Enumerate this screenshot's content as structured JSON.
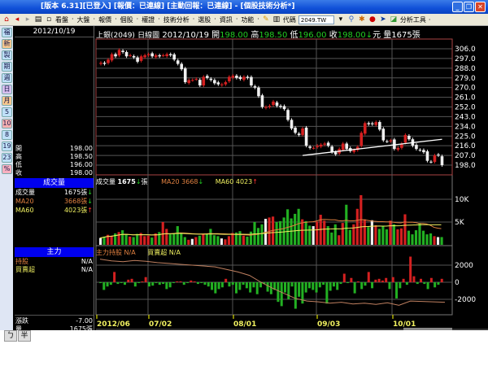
{
  "window": {
    "title": "[版本 6.31][已登入] [報價：已連線] [主動回報：已連線] - [個股技術分析*]"
  },
  "toolbar": {
    "menus": [
      "看盤",
      "大盤",
      "報價",
      "個股",
      "權證",
      "技術分析",
      "選股",
      "資訊",
      "功能"
    ],
    "code_label": "代碼",
    "code_value": "2049.TW",
    "analysis_tools": "分析工具"
  },
  "sidebar": {
    "buttons": [
      "福",
      "新",
      "製",
      "期",
      "週",
      "日",
      "月",
      "5",
      "10",
      "8",
      "19",
      "23",
      "%"
    ]
  },
  "info": {
    "date": "2012/10/19",
    "ohlc": [
      {
        "label": "開",
        "value": "198.00"
      },
      {
        "label": "高",
        "value": "198.50"
      },
      {
        "label": "低",
        "value": "196.00"
      },
      {
        "label": "收",
        "value": "198.00"
      }
    ],
    "volume_header": "成交量",
    "volume_rows": [
      {
        "label": "成交量",
        "value": "1675張",
        "arrow": "↓",
        "color": "#ffffff",
        "arrow_color": "#22cc22"
      },
      {
        "label": "MA20",
        "value": "3668張",
        "arrow": "↓",
        "color": "#e08040",
        "arrow_color": "#22cc22"
      },
      {
        "label": "MA60",
        "value": "4023張",
        "arrow": "↑",
        "color": "#f0f060",
        "arrow_color": "#ff3030"
      }
    ],
    "mainforce_header": "主力",
    "mainforce_rows": [
      {
        "label": "持股",
        "value": "N/A",
        "color": "#e08040"
      },
      {
        "label": "買賣超",
        "value": "N/A",
        "color": "#f0f060"
      }
    ],
    "change_label": "漲跌",
    "change_value": "-7.00",
    "vol_label": "量",
    "vol_value": "1675張"
  },
  "chart": {
    "stock": "上銀(2049)",
    "period": "日線圖",
    "date": "2012/10/19",
    "open_label": "開",
    "open": "198.00",
    "high_label": "高",
    "high": "198.50",
    "low_label": "低",
    "low": "196.00",
    "close_label": "收",
    "close": "198.00",
    "arrow": "↓",
    "unit": "元",
    "vol_label": "量",
    "vol": "1675",
    "vol_unit": "張",
    "volume_legend": {
      "label": "成交量",
      "value": "1675",
      "arrow": "↓",
      "unit": "張",
      "ma20": "MA20 3668",
      "ma20_arrow": "↓",
      "ma60": "MA60 4023",
      "ma60_arrow": "↑"
    },
    "mainforce_legend": {
      "holding": "主力持股 N/A",
      "netbuy": "買賣超 N/A"
    },
    "x_ticks": [
      "2012/06",
      "07/02",
      "08/01",
      "09/03",
      "10/01"
    ]
  },
  "chart_data": [
    {
      "type": "candlestick",
      "title": "上銀(2049) 日線圖",
      "y_ticks": [
        306,
        297,
        288,
        279,
        270,
        261,
        252,
        243,
        234,
        225,
        216,
        207,
        198
      ],
      "ylim": [
        195,
        309
      ],
      "close": [
        293,
        292,
        296,
        301,
        299,
        305,
        303,
        299,
        300,
        298,
        294,
        299,
        300,
        301,
        299,
        300,
        299,
        300,
        301,
        300,
        296,
        292,
        287,
        275,
        277,
        277,
        278,
        272,
        280,
        279,
        277,
        274,
        273,
        273,
        275,
        280,
        281,
        279,
        278,
        280,
        279,
        272,
        270,
        262,
        252,
        252,
        253,
        257,
        253,
        252,
        250,
        240,
        232,
        228,
        226,
        232,
        216,
        214,
        214,
        216,
        217,
        218,
        216,
        210,
        208,
        213,
        218,
        213,
        211,
        212,
        215,
        228,
        237,
        236,
        236,
        238,
        231,
        221,
        220,
        221,
        213,
        214,
        218,
        226,
        222,
        216,
        213,
        212,
        210,
        202,
        201,
        207,
        207,
        198
      ],
      "trendline": {
        "from": [
          55,
          207
        ],
        "to": [
          93,
          222
        ]
      }
    },
    {
      "type": "bar",
      "title": "成交量",
      "unit": "K張",
      "y_ticks": [
        "10K",
        "5K"
      ],
      "ylim": [
        0,
        12
      ],
      "values": [
        1.5,
        1.8,
        2.2,
        2,
        2.5,
        2.8,
        3.2,
        2.4,
        1.8,
        1.7,
        2.4,
        2.6,
        1.9,
        2,
        1.6,
        2.5,
        2.8,
        5,
        3.5,
        2.3,
        2.6,
        4.1,
        2.6,
        1.7,
        1.1,
        1.3,
        1.7,
        2,
        2.4,
        2.4,
        3.5,
        2.1,
        1.9,
        1.4,
        1.2,
        1.9,
        2.6,
        2.7,
        3,
        2,
        1.8,
        2.9,
        5,
        3.7,
        4.5,
        5.7,
        6,
        6.2,
        5,
        5.2,
        6,
        7.8,
        5.8,
        6.8,
        7.9,
        5.6,
        5.2,
        4.2,
        4.1,
        5.1,
        6.6,
        5.3,
        4.1,
        2.7,
        4.5,
        2.1,
        4.8,
        8.8,
        3.3,
        4.5,
        7.9,
        10.9,
        5.6,
        3.9,
        5.4,
        4.3,
        3.5,
        4.2,
        3.4,
        5.3,
        4.5,
        3.4,
        3.6,
        6.7,
        3.1,
        2.3,
        3.2,
        4.8,
        3.1,
        2.3,
        2.5,
        1.9,
        1.7,
        1.7
      ]
    },
    {
      "type": "bar+line",
      "title": "主力持股 / 買賣超",
      "y_ticks": [
        2000,
        0,
        -2000
      ],
      "ylim": [
        -3600,
        3700
      ],
      "netbuy": [
        -100,
        -900,
        -500,
        -300,
        1200,
        -200,
        -100,
        -300,
        300,
        400,
        -500,
        -100,
        0,
        600,
        -500,
        -400,
        -100,
        -300,
        -200,
        -800,
        -600,
        -100,
        0,
        100,
        -300,
        -100,
        200,
        0,
        -200,
        -100,
        -300,
        -500,
        -900,
        -1300,
        -800,
        -600,
        400,
        -500,
        -300,
        -1300,
        -900,
        -300,
        -700,
        -1200,
        -600,
        -1400,
        -600,
        -200,
        -1100,
        -1400,
        -900,
        -2300,
        -2800,
        -1200,
        -2000,
        -500,
        -3100,
        -1700,
        -2500,
        -1200,
        -700,
        -900,
        -1200,
        -600,
        -300,
        -2500,
        -1000,
        -500,
        -900,
        -200,
        1000,
        -100,
        500,
        -1300,
        0,
        -800,
        -400,
        1200,
        -700,
        300,
        400,
        200,
        500,
        -800,
        600,
        -1900,
        -700,
        400,
        -300,
        3000,
        700,
        -200,
        400,
        -200,
        -800,
        500,
        -600,
        -300,
        400
      ],
      "holding": [
        2700,
        2500,
        2400,
        2550,
        2450,
        2300,
        2200,
        2100,
        2000,
        1900,
        1800,
        1500,
        1200,
        800,
        0,
        -700,
        -1300,
        -1900,
        -2200,
        -2300,
        -2450,
        -2350,
        -2550,
        -2450,
        -2600,
        -2400,
        -2700,
        -2200,
        -2250,
        -2300,
        -2350
      ]
    }
  ]
}
